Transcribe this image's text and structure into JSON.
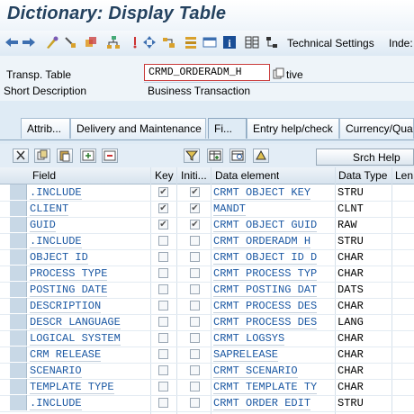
{
  "title": "Dictionary: Display Table",
  "toolbar": {
    "technical_settings": "Technical Settings",
    "indexes": "Inde:"
  },
  "header": {
    "transp_table_label": "Transp. Table",
    "transp_table_value": "CRMD_ORDERADM_H",
    "status_fragment": "tive",
    "short_desc_label": "Short Description",
    "short_desc_value": "Business Transaction"
  },
  "tabs": [
    "Attrib...",
    "Delivery and Maintenance",
    "Fi...",
    "Entry help/check",
    "Currency/Qua"
  ],
  "active_tab": "Fi...",
  "grid_toolbar": {
    "search_help": "Srch Help"
  },
  "columns": [
    "Field",
    "Key",
    "Initi...",
    "Data element",
    "Data Type",
    "Len"
  ],
  "rows": [
    {
      "field": ".INCLUDE",
      "key": true,
      "init": true,
      "element": "CRMT_OBJECT_KEY",
      "type": "STRU"
    },
    {
      "field": "CLIENT",
      "key": true,
      "init": true,
      "element": "MANDT",
      "type": "CLNT"
    },
    {
      "field": "GUID",
      "key": true,
      "init": true,
      "element": "CRMT_OBJECT_GUID",
      "type": "RAW"
    },
    {
      "field": ".INCLUDE",
      "key": false,
      "init": false,
      "element": "CRMT_ORDERADM_H",
      "type": "STRU"
    },
    {
      "field": "OBJECT_ID",
      "key": false,
      "init": false,
      "element": "CRMT_OBJECT_ID_D",
      "type": "CHAR"
    },
    {
      "field": "PROCESS_TYPE",
      "key": false,
      "init": false,
      "element": "CRMT_PROCESS_TYP",
      "type": "CHAR"
    },
    {
      "field": "POSTING_DATE",
      "key": false,
      "init": false,
      "element": "CRMT_POSTING_DAT",
      "type": "DATS"
    },
    {
      "field": "DESCRIPTION",
      "key": false,
      "init": false,
      "element": "CRMT_PROCESS_DES",
      "type": "CHAR"
    },
    {
      "field": "DESCR_LANGUAGE",
      "key": false,
      "init": false,
      "element": "CRMT_PROCESS_DES",
      "type": "LANG"
    },
    {
      "field": "LOGICAL_SYSTEM",
      "key": false,
      "init": false,
      "element": "CRMT_LOGSYS",
      "type": "CHAR"
    },
    {
      "field": "CRM_RELEASE",
      "key": false,
      "init": false,
      "element": "SAPRELEASE",
      "type": "CHAR"
    },
    {
      "field": "SCENARIO",
      "key": false,
      "init": false,
      "element": "CRMT_SCENARIO",
      "type": "CHAR"
    },
    {
      "field": "TEMPLATE_TYPE",
      "key": false,
      "init": false,
      "element": "CRMT_TEMPLATE_TY",
      "type": "CHAR"
    },
    {
      "field": ".INCLUDE",
      "key": false,
      "init": false,
      "element": "CRMT_ORDER_EDIT",
      "type": "STRU"
    }
  ],
  "colors": {
    "link": "#1b58a3",
    "title": "#24425f",
    "background": "#dfebf5",
    "field_border": "#c93a3a"
  }
}
